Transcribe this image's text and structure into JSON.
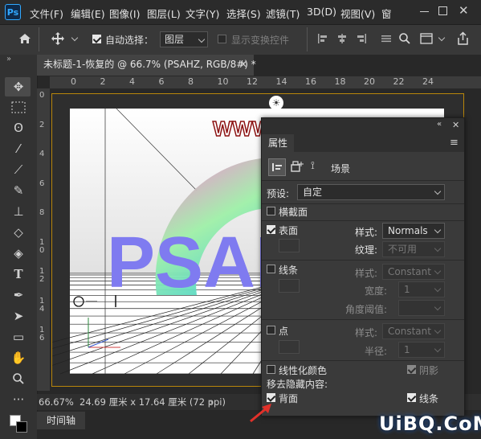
{
  "app": {
    "logo_text": "Ps"
  },
  "menu": [
    "文件(F)",
    "编辑(E)",
    "图像(I)",
    "图层(L)",
    "文字(Y)",
    "选择(S)",
    "滤镜(T)",
    "3D(D)",
    "视图(V)",
    "窗"
  ],
  "options": {
    "auto_select_label": "自动选择：",
    "auto_select_checked": true,
    "auto_select_value": "图层",
    "show_transform_label": "显示变换控件",
    "show_transform_checked": false
  },
  "document": {
    "tab_title": "未标题-1-恢复的 @ 66.7% (PSAHZ, RGB/8#) *",
    "ruler_top": [
      "0",
      "2",
      "4",
      "6",
      "8",
      "10",
      "12",
      "14",
      "16",
      "18",
      "20",
      "22",
      "24"
    ],
    "ruler_left": [
      "0",
      "2",
      "4",
      "6",
      "8",
      "1 0",
      "1 2",
      "1 4",
      "1 6"
    ],
    "canvas_text": "PSAH",
    "canvas_url_text": "WWW.PSAHZ.COM"
  },
  "status": {
    "zoom": "66.67%",
    "doc_info": "24.69 厘米 x 17.64 厘米 (72 ppi)"
  },
  "timeline": {
    "tab_label": "时间轴"
  },
  "properties": {
    "panel_title": "属性",
    "tab_scene_label": "场景",
    "preset_label": "预设:",
    "preset_value": "自定",
    "cross_section_label": "横截面",
    "cross_section_checked": false,
    "surface": {
      "label": "表面",
      "checked": true,
      "style_label": "样式:",
      "style_value": "Normals",
      "texture_label": "纹理:",
      "texture_value": "不可用"
    },
    "lines": {
      "label": "线条",
      "checked": false,
      "style_label": "样式:",
      "style_value": "Constant",
      "width_label": "宽度:",
      "width_value": "1",
      "angle_label": "角度阈值:",
      "angle_value": ""
    },
    "points": {
      "label": "点",
      "checked": false,
      "style_label": "样式:",
      "style_value": "Constant",
      "radius_label": "半径:",
      "radius_value": "1"
    },
    "linearize_label": "线性化颜色",
    "linearize_checked": false,
    "shadow_label": "阴影",
    "shadow_checked": true,
    "remove_hidden_label": "移去隐藏内容:",
    "backface_label": "背面",
    "backface_checked": true,
    "lines_hidden_label": "线条",
    "lines_hidden_checked": true
  },
  "watermark": "UiBQ.CoM",
  "colors": {
    "accent": "#31a8ff",
    "doc_border": "#b8860b",
    "arrow": "#e0312a",
    "text_purple": "#7f7bf0"
  }
}
